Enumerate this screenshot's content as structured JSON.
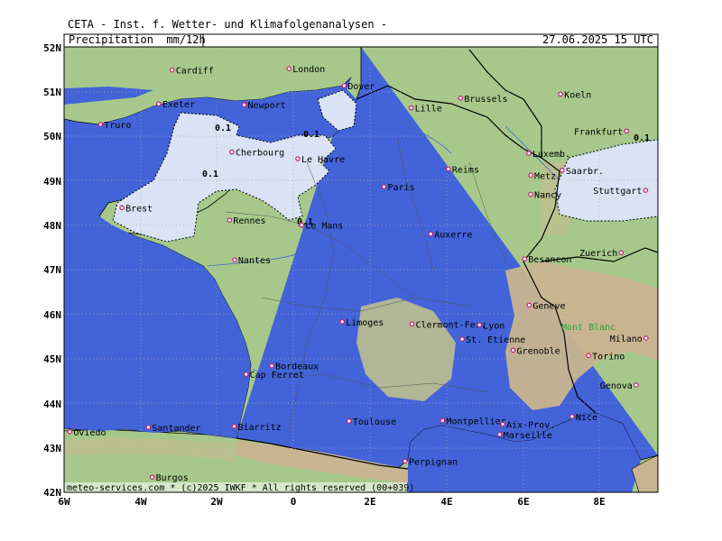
{
  "header": {
    "source": "CETA - Inst. f. Wetter- und Klimafolgenanalysen -",
    "product": "Precipitation  mm/12h",
    "valid_time": "27.06.2025 15 UTC"
  },
  "footer": "meteo-services.com * (c)2025 IWKF * All rights reserved (00+039)",
  "axes": {
    "lon_ticks": [
      "6W",
      "4W",
      "2W",
      "0",
      "2E",
      "4E",
      "6E",
      "8E"
    ],
    "lat_ticks": [
      "52N",
      "51N",
      "50N",
      "49N",
      "48N",
      "47N",
      "46N",
      "45N",
      "44N",
      "43N",
      "42N"
    ]
  },
  "contour_labels": [
    "0.1",
    "0.1",
    "0.1",
    "0.1",
    "0.1"
  ],
  "cities": [
    {
      "name": "Cardiff",
      "lon": -3.18,
      "lat": 51.48
    },
    {
      "name": "London",
      "lon": -0.13,
      "lat": 51.51
    },
    {
      "name": "Dover",
      "lon": 1.31,
      "lat": 51.13
    },
    {
      "name": "Exeter",
      "lon": -3.53,
      "lat": 50.72
    },
    {
      "name": "Newport",
      "lon": -1.3,
      "lat": 50.7
    },
    {
      "name": "Truro",
      "lon": -5.05,
      "lat": 50.26
    },
    {
      "name": "Lille",
      "lon": 3.06,
      "lat": 50.63
    },
    {
      "name": "Brussels",
      "lon": 4.35,
      "lat": 50.85
    },
    {
      "name": "Koeln",
      "lon": 6.96,
      "lat": 50.94
    },
    {
      "name": "Frankfurt",
      "lon": 8.68,
      "lat": 50.11
    },
    {
      "name": "Luxemb.",
      "lon": 6.13,
      "lat": 49.61
    },
    {
      "name": "Saarbr.",
      "lon": 7.0,
      "lat": 49.23
    },
    {
      "name": "Metz",
      "lon": 6.18,
      "lat": 49.12
    },
    {
      "name": "Nancy",
      "lon": 6.18,
      "lat": 48.69
    },
    {
      "name": "Stuttgart",
      "lon": 9.18,
      "lat": 48.78
    },
    {
      "name": "Reims",
      "lon": 4.03,
      "lat": 49.26
    },
    {
      "name": "Paris",
      "lon": 2.35,
      "lat": 48.86
    },
    {
      "name": "Le Havre",
      "lon": 0.1,
      "lat": 49.49
    },
    {
      "name": "Cherbourg",
      "lon": -1.62,
      "lat": 49.64
    },
    {
      "name": "Brest",
      "lon": -4.49,
      "lat": 48.39
    },
    {
      "name": "Rennes",
      "lon": -1.68,
      "lat": 48.11
    },
    {
      "name": "Le Mans",
      "lon": 0.2,
      "lat": 48.0
    },
    {
      "name": "Auxerre",
      "lon": 3.57,
      "lat": 47.8
    },
    {
      "name": "Nantes",
      "lon": -1.55,
      "lat": 47.22
    },
    {
      "name": "Besancon",
      "lon": 6.02,
      "lat": 47.24
    },
    {
      "name": "Zuerich",
      "lon": 8.54,
      "lat": 47.38
    },
    {
      "name": "Geneve",
      "lon": 6.14,
      "lat": 46.2
    },
    {
      "name": "Limoges",
      "lon": 1.26,
      "lat": 45.83
    },
    {
      "name": "Clermont-Fer.",
      "lon": 3.08,
      "lat": 45.78
    },
    {
      "name": "Lyon",
      "lon": 4.84,
      "lat": 45.76
    },
    {
      "name": "St. Etienne",
      "lon": 4.39,
      "lat": 45.44
    },
    {
      "name": "Grenoble",
      "lon": 5.72,
      "lat": 45.19
    },
    {
      "name": "Milano",
      "lon": 9.19,
      "lat": 45.46
    },
    {
      "name": "Torino",
      "lon": 7.69,
      "lat": 45.07
    },
    {
      "name": "Bordeaux",
      "lon": -0.58,
      "lat": 44.84
    },
    {
      "name": "Cap Ferret",
      "lon": -1.25,
      "lat": 44.65
    },
    {
      "name": "Genova",
      "lon": 8.93,
      "lat": 44.41
    },
    {
      "name": "Toulouse",
      "lon": 1.44,
      "lat": 43.6
    },
    {
      "name": "Montpellier",
      "lon": 3.88,
      "lat": 43.61
    },
    {
      "name": "Nice",
      "lon": 7.26,
      "lat": 43.7
    },
    {
      "name": "Aix-Prov.",
      "lon": 5.45,
      "lat": 43.53
    },
    {
      "name": "Marseille",
      "lon": 5.37,
      "lat": 43.3
    },
    {
      "name": "Biarritz",
      "lon": -1.56,
      "lat": 43.48
    },
    {
      "name": "Oviedo",
      "lon": -5.85,
      "lat": 43.36
    },
    {
      "name": "Santander",
      "lon": -3.8,
      "lat": 43.46
    },
    {
      "name": "Perpignan",
      "lon": 2.9,
      "lat": 42.7
    },
    {
      "name": "Burgos",
      "lon": -3.7,
      "lat": 42.34
    }
  ],
  "mountain_label": "Mont Blanc",
  "colors": {
    "sea": "#4363d9",
    "land_low": "#a6c98b",
    "land_mid": "#bdbf8e",
    "land_high": "#c9b48f",
    "precip_light": "#d9e3f5",
    "frame": "#000000"
  }
}
